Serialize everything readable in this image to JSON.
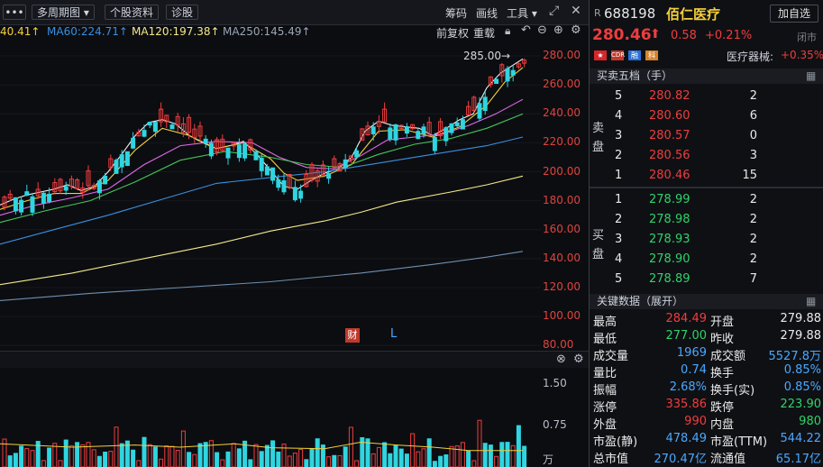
{
  "toolbar": {
    "menu_label": "•••",
    "period_label": "多周期图 ▾",
    "stock_info_label": "个股资料",
    "diagnose_label": "诊股",
    "chips_label": "筹码",
    "draw_label": "画线",
    "tools_label": "工具 ▾"
  },
  "ma": {
    "ma_cut": "40.41↑",
    "ma60": "MA60:224.71↑",
    "ma120": "MA120:197.38↑",
    "ma250": "MA250:145.49↑"
  },
  "chart_controls": {
    "fq_label": "前复权",
    "zoom_label": "重载"
  },
  "price_axis": [
    "280.00",
    "260.00",
    "240.00",
    "220.00",
    "200.00",
    "180.00",
    "160.00",
    "140.00",
    "120.00",
    "100.00",
    "80.00"
  ],
  "vol_axis": [
    "1.50",
    "0.75",
    "万"
  ],
  "markers": {
    "high_annotation": "285.00→",
    "cai": "财",
    "l": "L"
  },
  "colors": {
    "up": "#ef3d3d",
    "down": "#2fd5e0",
    "ma5": "#f2f2f2",
    "ma10": "#f4d03a",
    "ma20": "#e06ae8",
    "ma30": "#44c65a",
    "ma60": "#3a8fe0",
    "ma120": "#f3e98a",
    "ma250": "#6f8fb0"
  },
  "stock": {
    "prefix": "R",
    "code": "688198",
    "name": "佰仁医疗",
    "watch_button": "加自选",
    "price": "280.46",
    "arrow": "⬆",
    "change": "0.58",
    "pct": "+0.21%",
    "status": "闭市",
    "industry": "医疗器械:",
    "industry_pct": "+0.35%",
    "tags": [
      "CDR",
      "融",
      "科"
    ]
  },
  "orderbook": {
    "title": "买卖五档（手）",
    "sell_label": [
      "卖",
      "盘"
    ],
    "buy_label": [
      "买",
      "盘"
    ],
    "sells": [
      {
        "level": "5",
        "price": "280.82",
        "qty": "2"
      },
      {
        "level": "4",
        "price": "280.60",
        "qty": "6"
      },
      {
        "level": "3",
        "price": "280.57",
        "qty": "0"
      },
      {
        "level": "2",
        "price": "280.56",
        "qty": "3"
      },
      {
        "level": "1",
        "price": "280.46",
        "qty": "15"
      }
    ],
    "buys": [
      {
        "level": "1",
        "price": "278.99",
        "qty": "2"
      },
      {
        "level": "2",
        "price": "278.98",
        "qty": "2"
      },
      {
        "level": "3",
        "price": "278.93",
        "qty": "2"
      },
      {
        "level": "4",
        "price": "278.90",
        "qty": "2"
      },
      {
        "level": "5",
        "price": "278.89",
        "qty": "7"
      }
    ]
  },
  "keydata": {
    "title": "关键数据（展开）",
    "rows": [
      {
        "l1": "最高",
        "v1": "284.49",
        "c1": "red",
        "l2": "开盘",
        "v2": "279.88",
        "c2": "white"
      },
      {
        "l1": "最低",
        "v1": "277.00",
        "c1": "green",
        "l2": "昨收",
        "v2": "279.88",
        "c2": "white"
      },
      {
        "l1": "成交量",
        "v1": "1969",
        "c1": "blue",
        "l2": "成交额",
        "v2": "5527.8万",
        "c2": "blue"
      },
      {
        "l1": "量比",
        "v1": "0.74",
        "c1": "blue",
        "l2": "换手",
        "v2": "0.85%",
        "c2": "blue"
      },
      {
        "l1": "振幅",
        "v1": "2.68%",
        "c1": "blue",
        "l2": "换手(实)",
        "v2": "0.85%",
        "c2": "blue"
      },
      {
        "l1": "涨停",
        "v1": "335.86",
        "c1": "red",
        "l2": "跌停",
        "v2": "223.90",
        "c2": "green"
      },
      {
        "l1": "外盘",
        "v1": "990",
        "c1": "red",
        "l2": "内盘",
        "v2": "980",
        "c2": "green"
      },
      {
        "l1": "市盈(静)",
        "v1": "478.49",
        "c1": "blue",
        "l2": "市盈(TTM)",
        "v2": "544.22",
        "c2": "blue"
      },
      {
        "l1": "总市值",
        "v1": "270.47亿",
        "c1": "blue",
        "l2": "流通值",
        "v2": "65.17亿",
        "c2": "blue"
      }
    ]
  },
  "chart_data": {
    "type": "candlestick",
    "y_axis_ticks": [
      280,
      260,
      240,
      220,
      200,
      180,
      160,
      140,
      120,
      100,
      80
    ],
    "ylim": [
      77,
      290
    ],
    "volume_ylim": [
      0,
      1.8
    ],
    "ma_lines": {
      "ma5": [
        [
          0,
          177
        ],
        [
          15,
          181
        ],
        [
          30,
          184
        ],
        [
          45,
          186
        ],
        [
          60,
          188
        ],
        [
          75,
          191
        ],
        [
          90,
          187
        ],
        [
          105,
          190
        ],
        [
          120,
          200
        ],
        [
          135,
          212
        ],
        [
          150,
          225
        ],
        [
          165,
          234
        ],
        [
          180,
          236
        ],
        [
          195,
          233
        ],
        [
          210,
          225
        ],
        [
          225,
          220
        ],
        [
          240,
          216
        ],
        [
          255,
          218
        ],
        [
          270,
          221
        ],
        [
          285,
          212
        ],
        [
          300,
          201
        ],
        [
          315,
          190
        ],
        [
          330,
          188
        ],
        [
          345,
          194
        ],
        [
          360,
          199
        ],
        [
          375,
          202
        ],
        [
          390,
          210
        ],
        [
          405,
          228
        ],
        [
          420,
          235
        ],
        [
          435,
          232
        ],
        [
          450,
          231
        ],
        [
          465,
          230
        ],
        [
          480,
          225
        ],
        [
          495,
          230
        ],
        [
          510,
          236
        ],
        [
          525,
          240
        ],
        [
          540,
          258
        ],
        [
          555,
          268
        ],
        [
          570,
          274
        ],
        [
          580,
          278
        ]
      ],
      "ma10": [
        [
          0,
          174
        ],
        [
          30,
          180
        ],
        [
          60,
          185
        ],
        [
          90,
          185
        ],
        [
          120,
          194
        ],
        [
          150,
          215
        ],
        [
          180,
          230
        ],
        [
          210,
          225
        ],
        [
          240,
          216
        ],
        [
          270,
          220
        ],
        [
          300,
          209
        ],
        [
          315,
          199
        ],
        [
          330,
          194
        ],
        [
          360,
          197
        ],
        [
          390,
          205
        ],
        [
          420,
          228
        ],
        [
          450,
          229
        ],
        [
          480,
          224
        ],
        [
          510,
          231
        ],
        [
          540,
          246
        ],
        [
          560,
          262
        ],
        [
          580,
          272
        ]
      ],
      "ma20": [
        [
          0,
          170
        ],
        [
          40,
          177
        ],
        [
          80,
          182
        ],
        [
          120,
          188
        ],
        [
          160,
          205
        ],
        [
          200,
          218
        ],
        [
          240,
          221
        ],
        [
          280,
          220
        ],
        [
          310,
          210
        ],
        [
          340,
          203
        ],
        [
          370,
          202
        ],
        [
          400,
          211
        ],
        [
          430,
          222
        ],
        [
          460,
          224
        ],
        [
          490,
          226
        ],
        [
          520,
          232
        ],
        [
          550,
          240
        ],
        [
          580,
          250
        ]
      ],
      "ma30": [
        [
          0,
          165
        ],
        [
          50,
          173
        ],
        [
          100,
          180
        ],
        [
          150,
          193
        ],
        [
          200,
          208
        ],
        [
          250,
          214
        ],
        [
          300,
          210
        ],
        [
          340,
          205
        ],
        [
          380,
          203
        ],
        [
          420,
          212
        ],
        [
          460,
          219
        ],
        [
          500,
          223
        ],
        [
          540,
          230
        ],
        [
          580,
          240
        ]
      ],
      "ma60": [
        [
          0,
          150
        ],
        [
          60,
          160
        ],
        [
          120,
          170
        ],
        [
          180,
          181
        ],
        [
          240,
          192
        ],
        [
          300,
          196
        ],
        [
          360,
          200
        ],
        [
          420,
          206
        ],
        [
          480,
          212
        ],
        [
          540,
          218
        ],
        [
          580,
          224
        ]
      ],
      "ma120": [
        [
          0,
          122
        ],
        [
          80,
          130
        ],
        [
          160,
          140
        ],
        [
          240,
          150
        ],
        [
          300,
          159
        ],
        [
          360,
          166
        ],
        [
          400,
          172
        ],
        [
          440,
          179
        ],
        [
          500,
          186
        ],
        [
          540,
          191
        ],
        [
          580,
          197
        ]
      ],
      "ma250": [
        [
          0,
          111
        ],
        [
          100,
          116
        ],
        [
          200,
          120
        ],
        [
          300,
          124
        ],
        [
          400,
          130
        ],
        [
          480,
          136
        ],
        [
          540,
          141
        ],
        [
          580,
          145
        ]
      ]
    },
    "volume_series": {
      "ma": [
        [
          0,
          0.42
        ],
        [
          80,
          0.36
        ],
        [
          150,
          0.4
        ],
        [
          200,
          0.36
        ],
        [
          260,
          0.42
        ],
        [
          300,
          0.35
        ],
        [
          360,
          0.33
        ],
        [
          400,
          0.45
        ],
        [
          440,
          0.4
        ],
        [
          480,
          0.36
        ],
        [
          520,
          0.3
        ],
        [
          580,
          0.3
        ]
      ]
    }
  }
}
